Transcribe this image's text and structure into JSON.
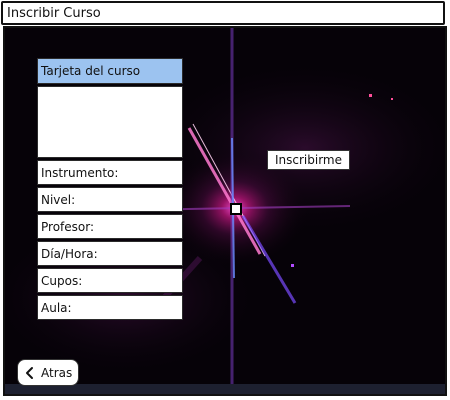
{
  "window": {
    "title": "Inscribir Curso"
  },
  "card": {
    "header": "Tarjeta del curso"
  },
  "fields": [
    {
      "label": "Instrumento:"
    },
    {
      "label": "Nivel:"
    },
    {
      "label": "Profesor:"
    },
    {
      "label": "Día/Hora:"
    },
    {
      "label": "Cupos:"
    },
    {
      "label": "Aula:"
    }
  ],
  "actions": {
    "enroll_label": "Inscribirme",
    "back_label": "Atras"
  },
  "icons": {
    "back": "chevron-left-icon"
  },
  "colors": {
    "card_header": "#9cc3f0",
    "background": "#060208",
    "star_core": "#ff66cc"
  }
}
